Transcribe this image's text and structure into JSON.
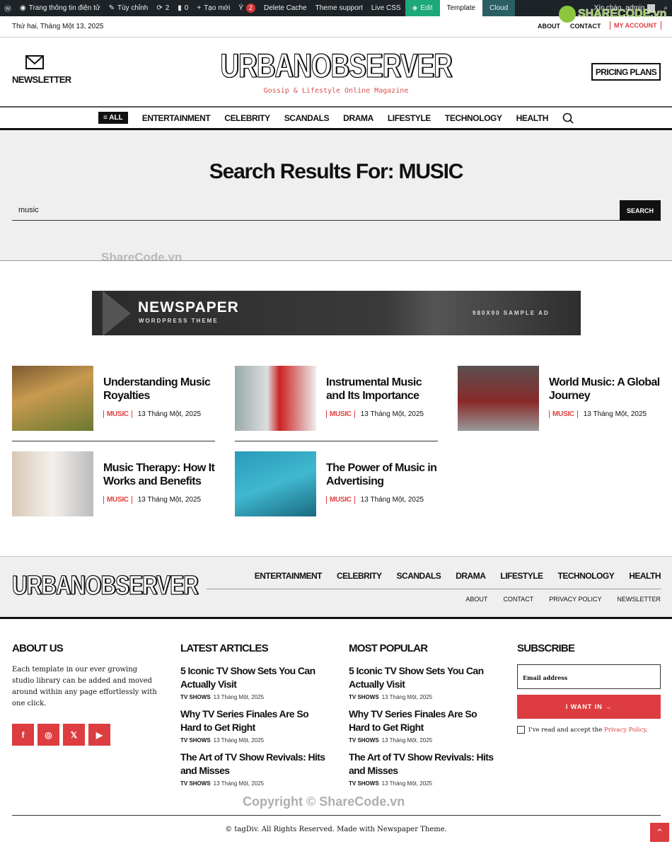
{
  "adminbar": {
    "site": "Trang thông tin điện tử",
    "customize": "Tùy chỉnh",
    "updates": "2",
    "comments": "0",
    "new": "Tạo mới",
    "yoast_count": "2",
    "delete_cache": "Delete Cache",
    "theme_support": "Theme support",
    "live_css": "Live CSS",
    "edit": "Edit",
    "template": "Template",
    "cloud": "Cloud",
    "greeting": "Xin chào, admin"
  },
  "topbar": {
    "date": "Thứ hai, Tháng Một 13, 2025",
    "links": [
      "ABOUT",
      "CONTACT",
      "MY ACCOUNT"
    ]
  },
  "header": {
    "newsletter": "NEWSLETTER",
    "logo": "URBANOBSERVER",
    "tagline": "Gossip & Lifestyle Online Magazine",
    "pricing": "PRICING PLANS"
  },
  "nav": {
    "all": "ALL",
    "items": [
      "ENTERTAINMENT",
      "CELEBRITY",
      "SCANDALS",
      "DRAMA",
      "LIFESTYLE",
      "TECHNOLOGY",
      "HEALTH"
    ]
  },
  "search": {
    "title": "Search Results For: MUSIC",
    "value": "music",
    "button": "SEARCH"
  },
  "ad": {
    "brand": "NEWSPAPER",
    "sub": "WORDPRESS THEME",
    "label": "980X90 SAMPLE AD"
  },
  "posts": [
    {
      "title": "Understanding Music Royalties",
      "category": "MUSIC",
      "date": "13 Tháng Một, 2025"
    },
    {
      "title": "Instrumental Music and Its Importance",
      "category": "MUSIC",
      "date": "13 Tháng Một, 2025"
    },
    {
      "title": "World Music: A Global Journey",
      "category": "MUSIC",
      "date": "13 Tháng Một, 2025"
    },
    {
      "title": "Music Therapy: How It Works and Benefits",
      "category": "MUSIC",
      "date": "13 Tháng Một, 2025"
    },
    {
      "title": "The Power of Music in Advertising",
      "category": "MUSIC",
      "date": "13 Tháng Một, 2025"
    }
  ],
  "footer": {
    "logo": "URBANOBSERVER",
    "nav": [
      "ENTERTAINMENT",
      "CELEBRITY",
      "SCANDALS",
      "DRAMA",
      "LIFESTYLE",
      "TECHNOLOGY",
      "HEALTH"
    ],
    "subnav": [
      "ABOUT",
      "CONTACT",
      "PRIVACY POLICY",
      "NEWSLETTER"
    ],
    "about": {
      "heading": "ABOUT US",
      "text": "Each template in our ever growing studio library can be added and moved around within any page effortlessly with one click."
    },
    "latest": {
      "heading": "LATEST ARTICLES",
      "items": [
        {
          "title": "5 Iconic TV Show Sets You Can Actually Visit",
          "category": "TV SHOWS",
          "date": "13 Tháng Một, 2025"
        },
        {
          "title": "Why TV Series Finales Are So Hard to Get Right",
          "category": "TV SHOWS",
          "date": "13 Tháng Một, 2025"
        },
        {
          "title": "The Art of TV Show Revivals: Hits and Misses",
          "category": "TV SHOWS",
          "date": "13 Tháng Một, 2025"
        }
      ]
    },
    "popular": {
      "heading": "MOST POPULAR",
      "items": [
        {
          "title": "5 Iconic TV Show Sets You Can Actually Visit",
          "category": "TV SHOWS",
          "date": "13 Tháng Một, 2025"
        },
        {
          "title": "Why TV Series Finales Are So Hard to Get Right",
          "category": "TV SHOWS",
          "date": "13 Tháng Một, 2025"
        },
        {
          "title": "The Art of TV Show Revivals: Hits and Misses",
          "category": "TV SHOWS",
          "date": "13 Tháng Một, 2025"
        }
      ]
    },
    "subscribe": {
      "heading": "SUBSCRIBE",
      "placeholder": "Email address",
      "button": "I WANT IN →",
      "consent": "I've read and accept the ",
      "policy": "Privacy Policy",
      "period": "."
    },
    "copyright": "© tagDiv. All Rights Reserved. Made with Newspaper Theme."
  },
  "watermark": {
    "top": "ShareCode.vn",
    "bottom": "Copyright © ShareCode.vn",
    "logo": "SHARECODE.vn"
  },
  "colors": {
    "accent": "#dd3c40",
    "adminbar": "#1d2327",
    "edit": "#1da87a",
    "cloud": "#2a5f63"
  }
}
